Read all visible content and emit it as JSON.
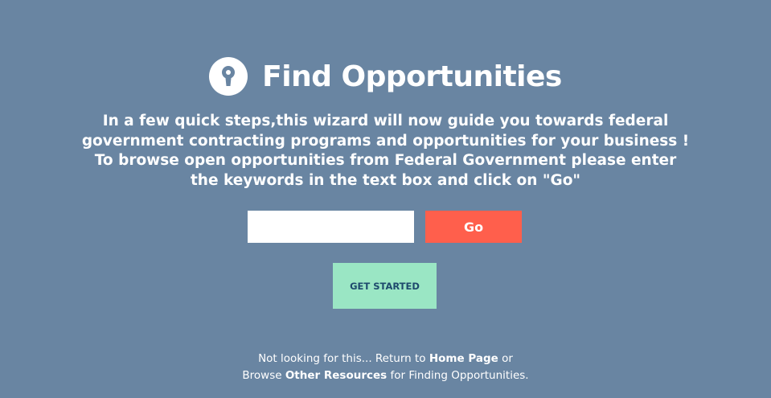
{
  "header": {
    "title": "Find Opportunities",
    "icon": "keyhole-lock-icon"
  },
  "intro": {
    "line1": "In a few quick steps,this wizard will now guide you towards federal government contracting programs and opportunities for your business !",
    "line2": "To browse open opportunities from Federal Government please enter the keywords in the text box and click on \"Go\""
  },
  "search": {
    "value": "",
    "placeholder": "",
    "go_label": "Go"
  },
  "actions": {
    "get_started_label": "GET STARTED"
  },
  "footer": {
    "line1_prefix": "Not looking for this... Return to ",
    "home_link": "Home Page",
    "line1_suffix": " or",
    "line2_prefix": "Browse ",
    "resources_link": "Other Resources",
    "line2_suffix": " for Finding Opportunities."
  },
  "colors": {
    "background": "#6985a2",
    "go_button": "#ff5f4c",
    "get_started_button": "#9ae6c4",
    "get_started_text": "#1e4a6d"
  }
}
